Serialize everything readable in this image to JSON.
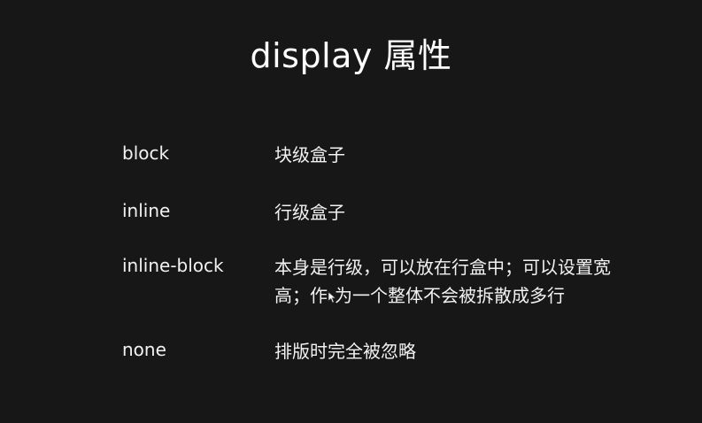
{
  "slide": {
    "title": "display 属性",
    "rows": [
      {
        "term": "block",
        "description": "块级盒子"
      },
      {
        "term": "inline",
        "description": "行级盒子"
      },
      {
        "term": "inline-block",
        "description_line1": "本身是行级，可以放在行盒中；可以设置宽",
        "description_line2_before_cursor": "高；作",
        "description_line2_after_cursor": "为一个整体不会被拆散成多行"
      },
      {
        "term": "none",
        "description": "排版时完全被忽略"
      }
    ]
  },
  "icons": {
    "cursor": "mouse-pointer-icon"
  }
}
